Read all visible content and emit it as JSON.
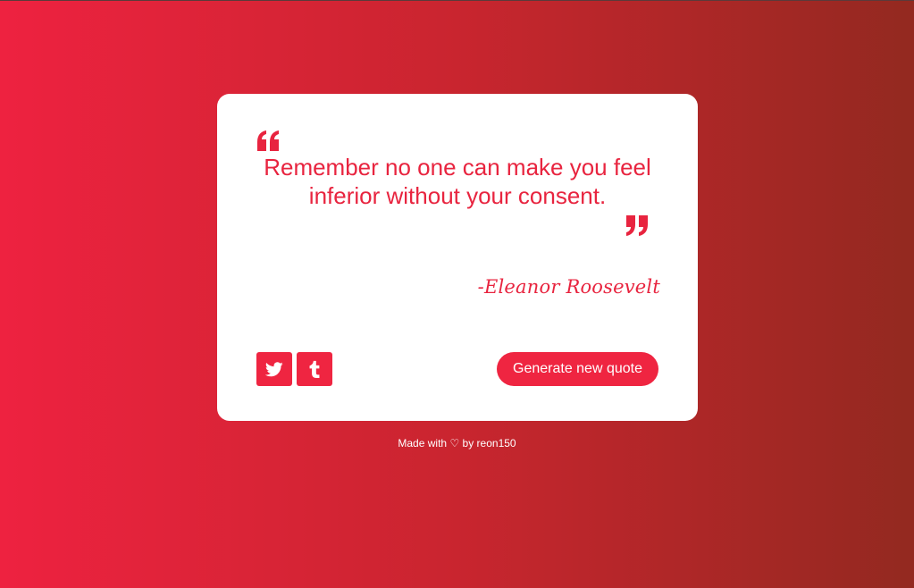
{
  "quote": {
    "text": "Remember no one can make you feel inferior without your consent.",
    "author": "-Eleanor Roosevelt",
    "open_mark_icon": "quote-left-icon",
    "close_mark_icon": "quote-right-icon"
  },
  "share": {
    "twitter_icon": "twitter-icon",
    "tumblr_icon": "tumblr-icon"
  },
  "actions": {
    "new_quote_label": "Generate new quote"
  },
  "footer": {
    "made_with": "Made with",
    "heart": "♡",
    "by": "by reon150"
  },
  "colors": {
    "accent": "#ef2541",
    "gradient_start": "#ee2240",
    "gradient_end": "#932920",
    "card": "#ffffff"
  }
}
